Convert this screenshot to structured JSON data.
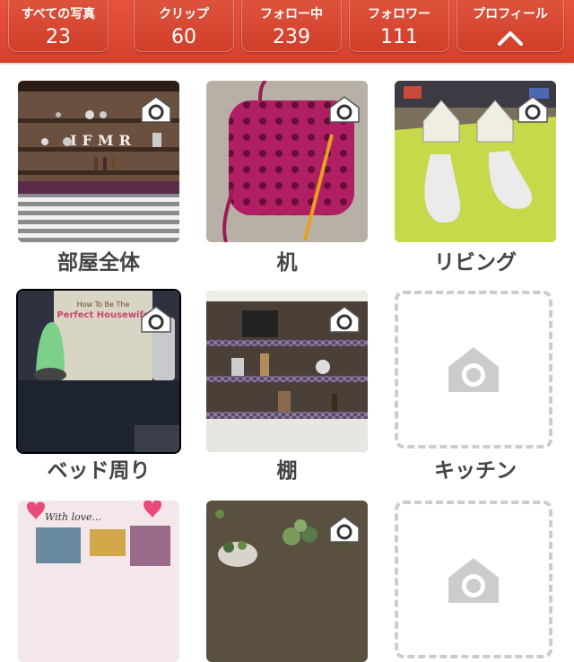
{
  "stats": [
    {
      "label": "すべての写真",
      "value": "23"
    },
    {
      "label": "クリップ",
      "value": "60"
    },
    {
      "label": "フォロー中",
      "value": "239"
    },
    {
      "label": "フォロワー",
      "value": "111"
    },
    {
      "label": "プロフィール",
      "icon": "chevron-up-icon"
    }
  ],
  "albums": [
    {
      "label": "部屋全体",
      "photo_text": "IFMR"
    },
    {
      "label": "机"
    },
    {
      "label": "リビング"
    },
    {
      "label": "ベッド周り",
      "photo_text_1": "How To Be The",
      "photo_text_2": "Perfect Housewife"
    },
    {
      "label": "棚"
    },
    {
      "label": "キッチン",
      "empty": true
    },
    {
      "label": "",
      "photo_text": "With love..."
    },
    {
      "label": ""
    },
    {
      "label": "",
      "empty": true
    }
  ],
  "colors": {
    "header": "#d84530",
    "caption": "#444444",
    "empty_border": "#cccccc",
    "camera_icon": "#cccccc"
  }
}
